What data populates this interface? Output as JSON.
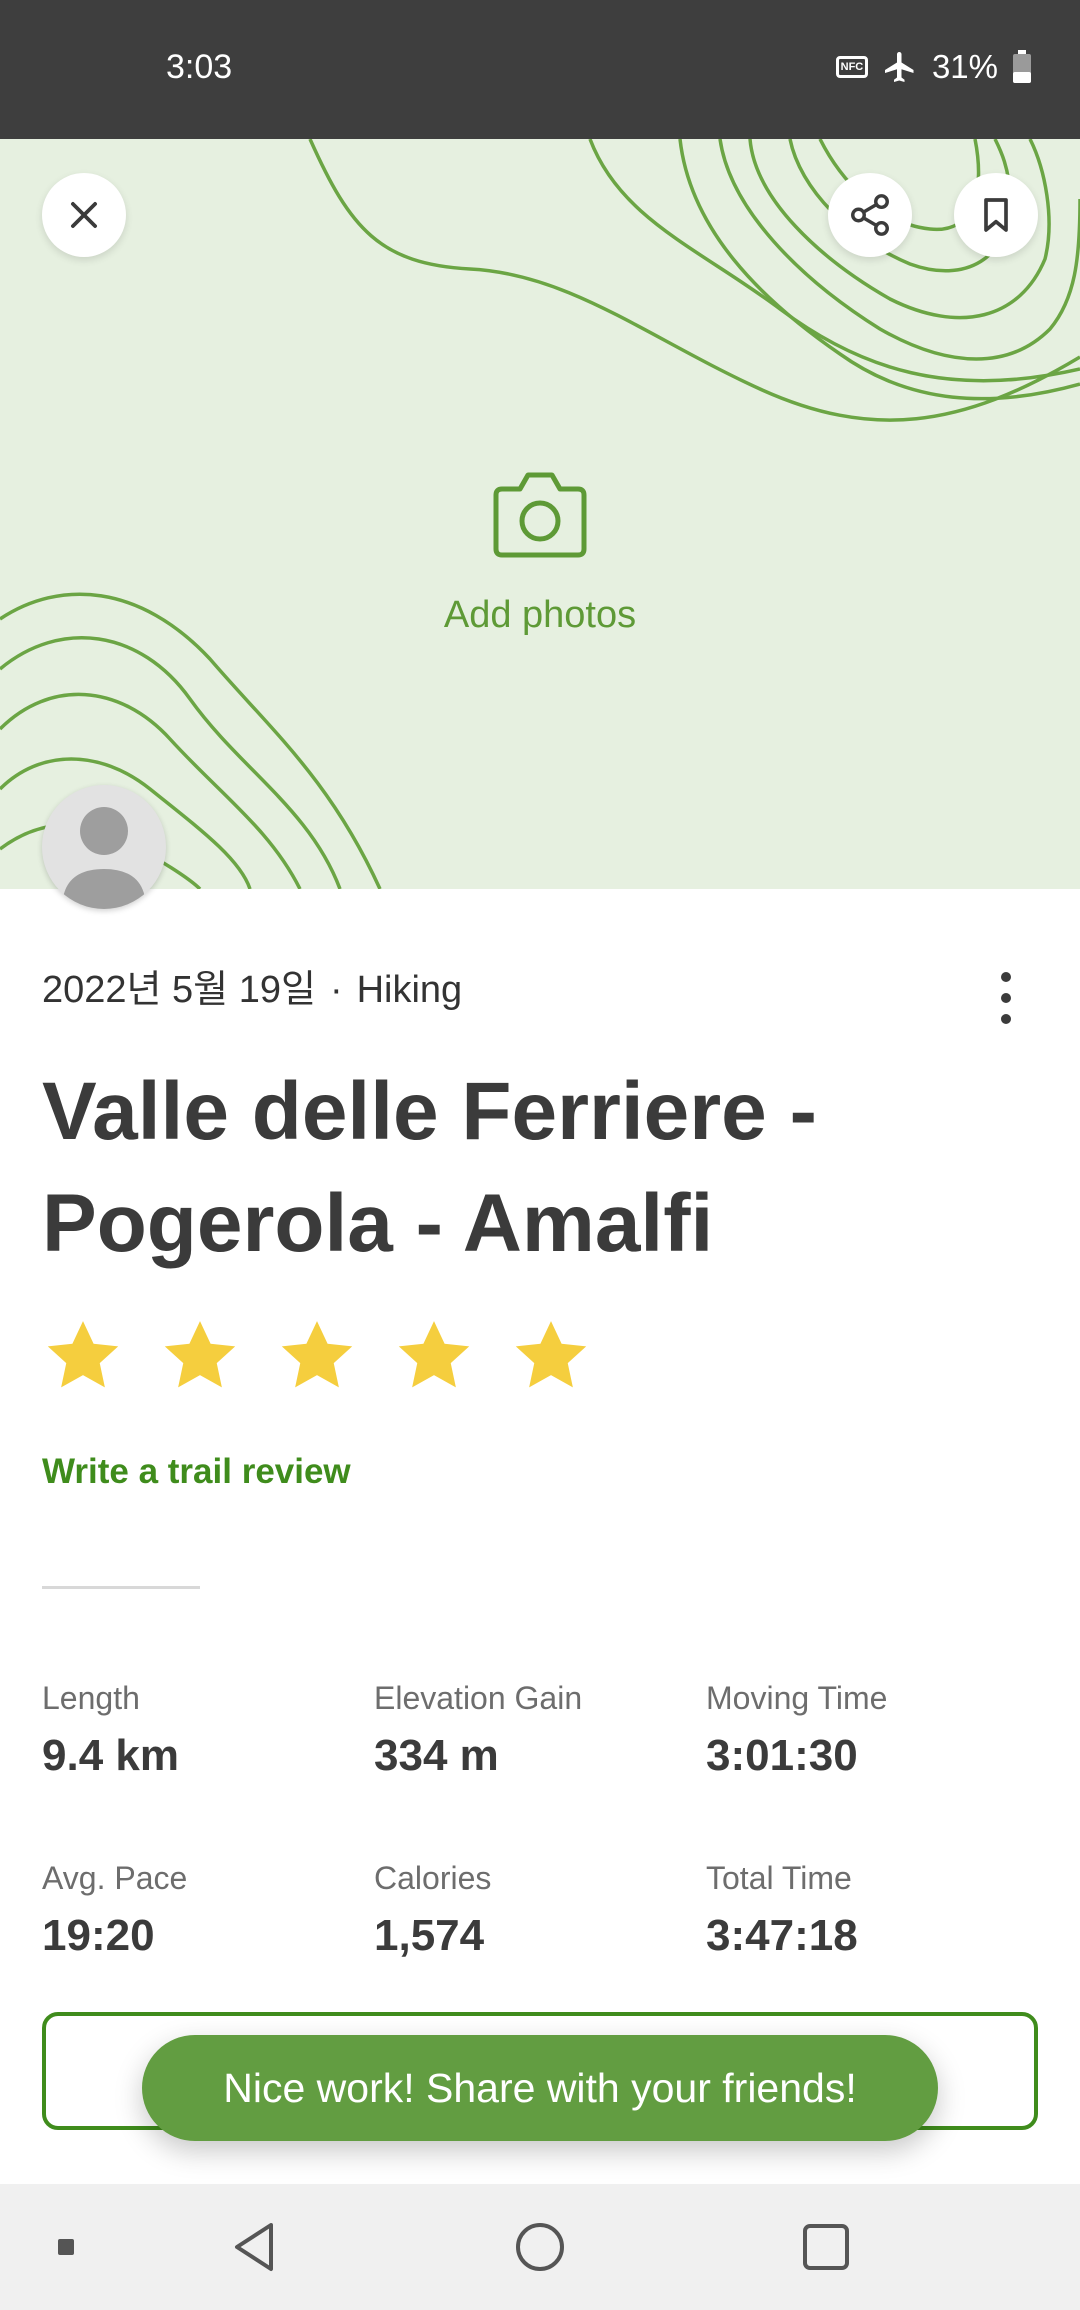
{
  "status_bar": {
    "time": "3:03",
    "nfc_label": "NFC",
    "battery": "31%"
  },
  "hero": {
    "add_photos_label": "Add photos",
    "close_icon": "close-icon",
    "share_icon": "share-icon",
    "bookmark_icon": "bookmark-icon",
    "camera_icon": "camera-icon"
  },
  "activity": {
    "date": "2022년 5월 19일",
    "separator": "·",
    "type": "Hiking",
    "title": "Valle delle Ferriere - Pogerola - Amalfi",
    "rating": 5,
    "rating_max": 5,
    "review_link": "Write a trail review"
  },
  "stats": [
    {
      "label": "Length",
      "value": "9.4 km"
    },
    {
      "label": "Elevation Gain",
      "value": "334 m"
    },
    {
      "label": "Moving Time",
      "value": "3:01:30"
    },
    {
      "label": "Avg. Pace",
      "value": "19:20"
    },
    {
      "label": "Calories",
      "value": "1,574"
    },
    {
      "label": "Total Time",
      "value": "3:47:18"
    }
  ],
  "toast": {
    "message": "Nice work! Share with your friends!"
  },
  "colors": {
    "accent": "#3f8c1c",
    "hero_bg": "#e6f0e0",
    "contour": "#6ba544",
    "star": "#f5ce3e",
    "toast_bg": "#629d41"
  }
}
